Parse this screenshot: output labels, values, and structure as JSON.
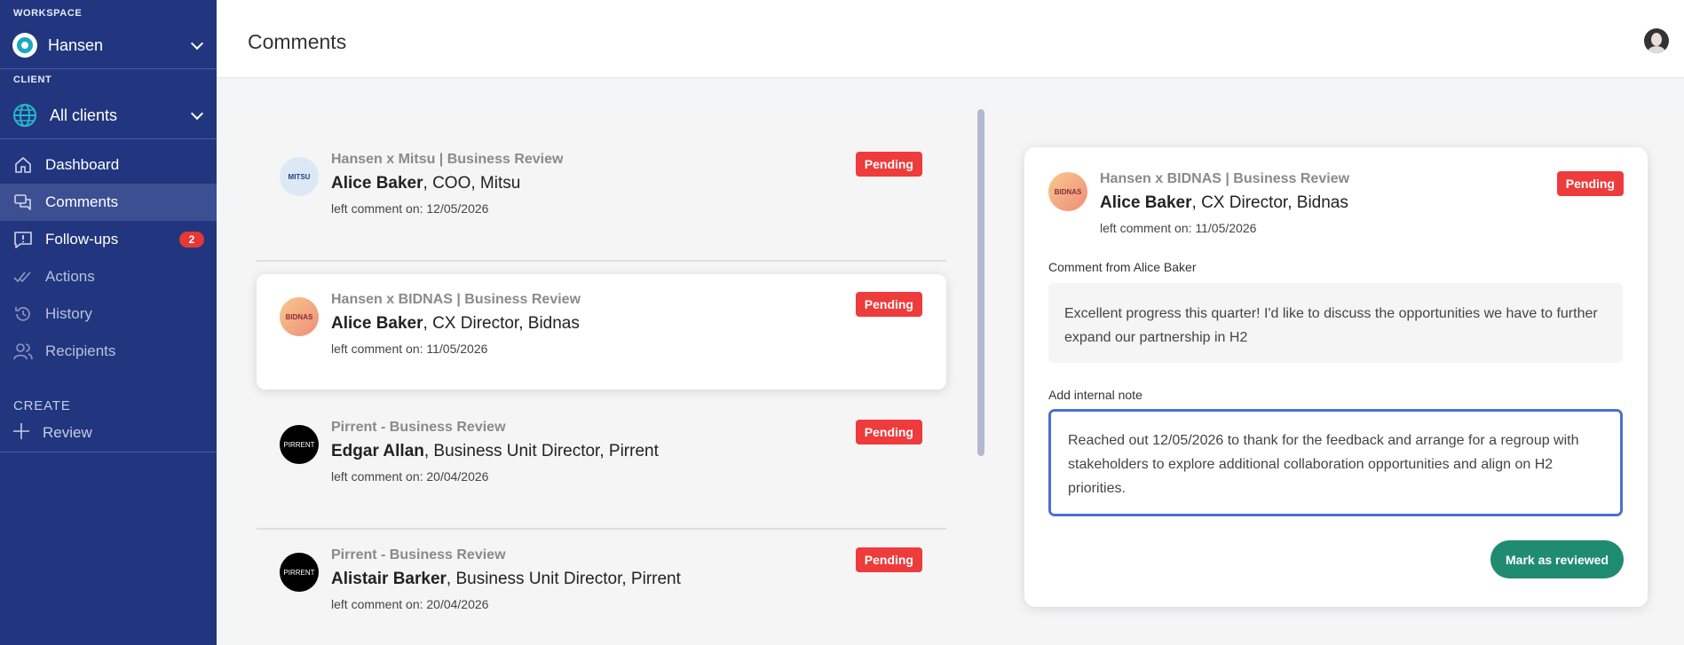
{
  "sidebar": {
    "workspace_caption": "WORKSPACE",
    "workspace_name": "Hansen",
    "client_caption": "CLIENT",
    "client_name": "All clients",
    "nav": [
      {
        "label": "Dashboard",
        "icon": "home-icon"
      },
      {
        "label": "Comments",
        "icon": "chat-bubbles-icon",
        "active": true
      },
      {
        "label": "Follow-ups",
        "icon": "alert-message-icon",
        "count": "2"
      },
      {
        "label": "Actions",
        "icon": "double-check-icon"
      },
      {
        "label": "History",
        "icon": "history-icon"
      },
      {
        "label": "Recipients",
        "icon": "users-icon"
      }
    ],
    "create_caption": "CREATE",
    "create_review": "Review"
  },
  "header": {
    "title": "Comments"
  },
  "comments": [
    {
      "project": "Hansen x Mitsu | Business Review",
      "name": "Alice Baker",
      "role": ", COO, Mitsu",
      "date": "left comment on: 12/05/2026",
      "status": "Pending",
      "logo_text": "MITSU"
    },
    {
      "project": "Hansen x BIDNAS | Business Review",
      "name": "Alice Baker",
      "role": ", CX Director, Bidnas",
      "date": "left comment on: 11/05/2026",
      "status": "Pending",
      "logo_text": "BIDNAS"
    },
    {
      "project": "Pirrent - Business Review",
      "name": "Edgar Allan",
      "role": ", Business Unit Director, Pirrent",
      "date": "left comment on: 20/04/2026",
      "status": "Pending",
      "logo_text": "PIRRENT"
    },
    {
      "project": "Pirrent - Business Review",
      "name": "Alistair Barker",
      "role": ", Business Unit Director, Pirrent",
      "date": "left comment on: 20/04/2026",
      "status": "Pending",
      "logo_text": "PIRRENT"
    }
  ],
  "detail": {
    "project": "Hansen x BIDNAS | Business Review",
    "name": "Alice Baker",
    "role": ", CX Director, Bidnas",
    "date": "left comment on: 11/05/2026",
    "status": "Pending",
    "logo_text": "BIDNAS",
    "comment_label": "Comment from Alice Baker",
    "comment_text": "Excellent progress this quarter! I'd like to discuss the opportunities we have to further expand our partnership in H2",
    "note_label": "Add internal note",
    "note_value": "Reached out 12/05/2026 to thank for the feedback and arrange for a regroup with stakeholders to explore additional collaboration opportunities and align on H2 priorities.",
    "mark_button": "Mark as reviewed"
  },
  "colors": {
    "sidebar": "#22367f",
    "pending": "#ee3b3b",
    "primary_button": "#1f8c72",
    "focus": "#4a6fd0"
  }
}
